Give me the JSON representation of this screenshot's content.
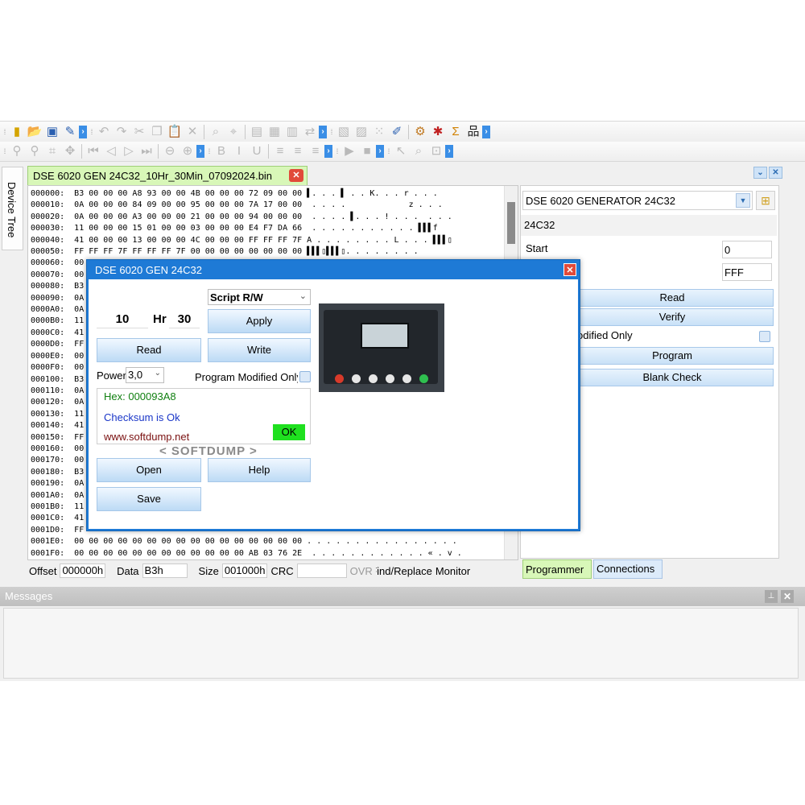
{
  "toolbar": {
    "row1_icons": [
      "chip-icon",
      "open-folder-icon",
      "save-icon",
      "edit-icon",
      "undo-icon",
      "redo-icon",
      "cut-icon",
      "copy-icon",
      "paste-icon",
      "delete-icon",
      "find-icon",
      "replace-icon",
      "document-icon",
      "hex-view-icon",
      "text-view-icon",
      "swap-icon",
      "page-icon",
      "page2-icon",
      "grid-icon",
      "note-icon",
      "settings-icon",
      "bug-icon",
      "sigma-icon",
      "network-icon"
    ],
    "row2_icons": [
      "zoom-in-icon",
      "zoom-out-icon",
      "crop-icon",
      "move-icon",
      "first-icon",
      "prev-icon",
      "next-icon",
      "last-icon",
      "back-icon",
      "forward-icon",
      "bold-icon",
      "italic-icon",
      "underline-icon",
      "align-left-icon",
      "align-center-icon",
      "align-right-icon",
      "play-icon",
      "stop-icon",
      "pointer-icon",
      "inspect-icon",
      "window-icon"
    ]
  },
  "side_tab": {
    "label": "Device Tree"
  },
  "document": {
    "tab_title": "DSE 6020 GEN 24C32_10Hr_30Min_07092024.bin",
    "hex_lines": [
      "000000:  B3 00 00 00 A8 93 00 00 4B 00 00 00 72 09 00 00 ▌. . . ▌ . . K. . . r . . .",
      "000010:  0A 00 00 00 84 09 00 00 95 00 00 00 7A 17 00 00  . . . .             z . . .",
      "000020:  0A 00 00 00 A3 00 00 00 21 00 00 00 94 00 00 00  . . . . ▌. . . ! . . .  . . .",
      "000030:  11 00 00 00 15 01 00 00 03 00 00 00 E4 F7 DA 66  . . . . . . . . . . . ▌▌▌f",
      "000040:  41 00 00 00 13 00 00 00 4C 00 00 00 FF FF FF 7F A . . . . . . . . L . . . ▌▌▌▯",
      "000050:  FF FF FF 7F FF FF FF 7F 00 00 00 00 00 00 00 00 ▌▌▌▯▌▌▌▯. . . . . . . .",
      "000060:  00",
      "000070:  00",
      "000080:  B3",
      "000090:  0A",
      "0000A0:  0A",
      "0000B0:  11",
      "0000C0:  41",
      "0000D0:  FF",
      "0000E0:  00",
      "0000F0:  00",
      "000100:  B3",
      "000110:  0A",
      "000120:  0A",
      "000130:  11",
      "000140:  41",
      "000150:  FF",
      "000160:  00",
      "000170:  00",
      "000180:  B3",
      "000190:  0A",
      "0001A0:  0A",
      "0001B0:  11",
      "0001C0:  41",
      "0001D0:  FF",
      "0001E0:  00 00 00 00 00 00 00 00 00 00 00 00 00 00 00 00 . . . . . . . . . . . . . . . .",
      "0001F0:  00 00 00 00 00 00 00 00 00 00 00 00 AB 03 76 2E  . . . . . . . . . . . . « . v ."
    ]
  },
  "status": {
    "offset_label": "Offset",
    "offset_value": "000000h",
    "data_label": "Data",
    "data_value": "B3h",
    "size_label": "Size",
    "size_value": "001000h",
    "crc_label": "CRC",
    "crc_value": "",
    "ovr_label": "OVR",
    "find_label": "Find/Replace",
    "monitor_label": "Monitor"
  },
  "programmer": {
    "device": "DSE 6020 GENERATOR 24C32",
    "chip": "24C32",
    "start_label": "Start",
    "start_value": "0",
    "end_value": "FFF",
    "read_label": "Read",
    "verify_label": "Verify",
    "modified_only_label": "odified Only",
    "program_label": "Program",
    "blank_check_label": "Blank Check"
  },
  "bottom_tabs": {
    "programmer": "Programmer",
    "connections": "Connections"
  },
  "messages": {
    "title": "Messages"
  },
  "dialog": {
    "title": "DSE 6020 GEN 24C32",
    "script_select": "Script R/W",
    "hours": "10",
    "hr_label": "Hr",
    "minutes": "30",
    "apply_label": "Apply",
    "read_label": "Read",
    "write_label": "Write",
    "power_label": "Power",
    "power_value": "3,0",
    "program_modified_label": "Program Modified Only",
    "hex_info": "Hex: 000093A8",
    "checksum_info": "Checksum is Ok",
    "url": "www.softdump.net",
    "ok_badge": "OK",
    "brand": "< SOFTDUMP >",
    "open_label": "Open",
    "help_label": "Help",
    "save_label": "Save"
  },
  "colors": {
    "accent_blue": "#1e7ad6",
    "tab_green": "#d8f7b8",
    "ok_green": "#1fe01f",
    "close_red": "#e14a3a"
  }
}
